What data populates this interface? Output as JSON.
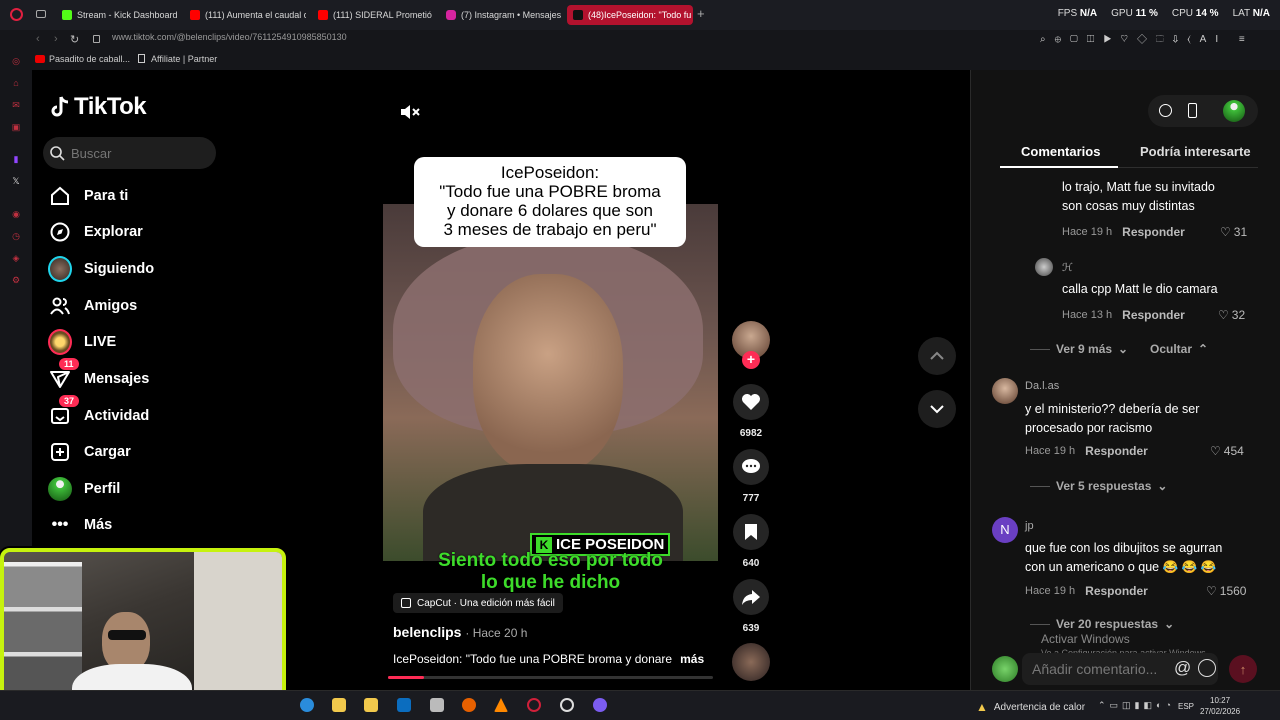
{
  "browser": {
    "tabs": [
      {
        "label": "Stream - Kick Dashboard",
        "color": "#53fc18"
      },
      {
        "label": "(111) Aumenta el caudal de",
        "color": "#ff0000"
      },
      {
        "label": "(111) SIDERAL Prometió 10",
        "color": "#ff0000"
      },
      {
        "label": "(7) Instagram • Mensajes",
        "color": "#d6249f"
      },
      {
        "label": "(48)IcePoseidon: \"Todo fu",
        "color": "#111111"
      }
    ],
    "stats": {
      "fps_label": "FPS",
      "fps_value": "N/A",
      "gpu_label": "GPU",
      "gpu_value": "11 %",
      "cpu_label": "CPU",
      "cpu_value": "14 %",
      "lat_label": "LAT",
      "lat_value": "N/A"
    },
    "url": "www.tiktok.com/@belenclips/video/7611254910985850130",
    "bookmarks": [
      "Pasadito de caball...",
      "Affiliate | Partner"
    ]
  },
  "tiktok": {
    "logo": "TikTok",
    "search_placeholder": "Buscar",
    "nav": [
      {
        "label": "Para ti",
        "icon": "home-icon"
      },
      {
        "label": "Explorar",
        "icon": "compass-icon"
      },
      {
        "label": "Siguiendo",
        "icon": "following-avatar-icon"
      },
      {
        "label": "Amigos",
        "icon": "friends-icon"
      },
      {
        "label": "LIVE",
        "icon": "live-icon"
      },
      {
        "label": "Mensajes",
        "icon": "messages-icon",
        "badge": "11"
      },
      {
        "label": "Actividad",
        "icon": "activity-icon",
        "badge": "37"
      },
      {
        "label": "Cargar",
        "icon": "upload-icon"
      },
      {
        "label": "Perfil",
        "icon": "profile-icon"
      },
      {
        "label": "Más",
        "icon": "more-icon"
      }
    ]
  },
  "video": {
    "caption": [
      "IcePoseidon:",
      "\"Todo fue una POBRE broma",
      "y donare 6 dolares que son",
      "3 meses de trabajo en peru\""
    ],
    "name_label": "ICE POSEIDON",
    "subtitle": [
      "Siento todo eso por todo",
      "lo que he dicho"
    ],
    "capcut": "CapCut · Una edición más fácil",
    "author": "belenclips",
    "time": "· Hace 20 h",
    "description": "IcePoseidon: \"Todo fue una POBRE broma y donare",
    "more": "más",
    "progress": 0.11
  },
  "actions": {
    "likes": "6982",
    "comments": "777",
    "saves": "640",
    "shares": "639"
  },
  "comments_panel": {
    "tab_comments": "Comentarios",
    "tab_interesting": "Podría interesarte",
    "items": [
      {
        "user": "",
        "text": [
          "lo trajo, Matt fue su invitado",
          "son cosas muy distintas"
        ],
        "time": "Hace 19 h",
        "reply": "Responder",
        "likes": "31"
      },
      {
        "user": "ℋ",
        "text": [
          "calla cpp Matt le dio camara"
        ],
        "time": "Hace 13 h",
        "reply": "Responder",
        "likes": "32"
      },
      {
        "user": "Da.l.as",
        "text": [
          "y el ministerio?? debería de ser",
          "procesado por racismo"
        ],
        "time": "Hace 19 h",
        "reply": "Responder",
        "likes": "454"
      },
      {
        "user": "jp",
        "text": [
          "que fue con los dibujitos se agurran",
          "con un americano o que 😂 😂 😂"
        ],
        "time": "Hace 19 h",
        "reply": "Responder",
        "likes": "1560"
      }
    ],
    "ver_9": "Ver 9 más",
    "ocultar": "Ocultar",
    "ver_5": "Ver 5 respuestas",
    "ver_20": "Ver 20 respuestas",
    "avatar_letter": "N",
    "add_comment_placeholder": "Añadir comentario...",
    "windows_watermark_title": "Activar Windows",
    "windows_watermark_sub": "Ve a Configuración para activar Windows."
  },
  "taskbar": {
    "heat_warning": "Advertencia de calor",
    "lang": "ESP",
    "time": "10:27",
    "date": "27/02/2026"
  }
}
